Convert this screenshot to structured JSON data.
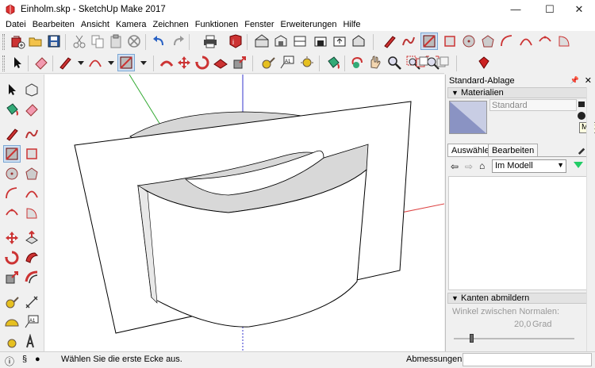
{
  "window": {
    "title": "Einholm.skp - SketchUp Make 2017",
    "minimize": "—",
    "maximize": "☐",
    "close": "✕"
  },
  "menu": [
    {
      "label": "Datei"
    },
    {
      "label": "Bearbeiten"
    },
    {
      "label": "Ansicht"
    },
    {
      "label": "Kamera"
    },
    {
      "label": "Zeichnen"
    },
    {
      "label": "Funktionen"
    },
    {
      "label": "Fenster"
    },
    {
      "label": "Erweiterungen"
    },
    {
      "label": "Hilfe"
    }
  ],
  "toolbar_top": {
    "icons": [
      "new-file",
      "open-file",
      "save-file",
      "cut",
      "copy",
      "paste",
      "erase",
      "undo",
      "redo",
      "print",
      "model-info",
      "component",
      "make-group",
      "section-fill",
      "warehouse",
      "share",
      "3d-text",
      "pencil",
      "freehand",
      "paint-bucket",
      "rectangle",
      "circle",
      "polygon",
      "arc",
      "pie",
      "pan"
    ]
  },
  "toolbar_second": {
    "icons": [
      "select",
      "eraser",
      "line",
      "arc-dropdown",
      "rectangle-dropdown",
      "push-pull",
      "move",
      "rotate",
      "follow-me",
      "scale",
      "offset",
      "tape-measure",
      "text",
      "protractor",
      "axes",
      "dimension",
      "3d-text",
      "orbit",
      "pan",
      "zoom",
      "zoom-extents",
      "previous-view",
      "next-view",
      "ruby-console"
    ]
  },
  "panel": {
    "title": "Standard-Ablage",
    "materials_header": "Materialien",
    "material_name": "Standard",
    "tooltip_fragment": "Mate",
    "tabs": {
      "select": "Auswählen",
      "edit": "Bearbeiten"
    },
    "library_select": "Im Modell",
    "soften_header": "Kanten abmildern",
    "normals_label": "Winkel zwischen Normalen:",
    "normals_value": "20,0",
    "normals_unit": "Grad",
    "slider_level_fraction": 0.13
  },
  "status": {
    "message": "Wählen Sie die erste Ecke aus.",
    "measure_label": "Abmessungen",
    "measure_value": ""
  },
  "colors": {
    "axis_red": "#d44",
    "axis_green": "#3a3",
    "axis_blue": "#33c",
    "surface": "#ffffff",
    "edge": "#000000",
    "shade": "#d8d8d8"
  }
}
